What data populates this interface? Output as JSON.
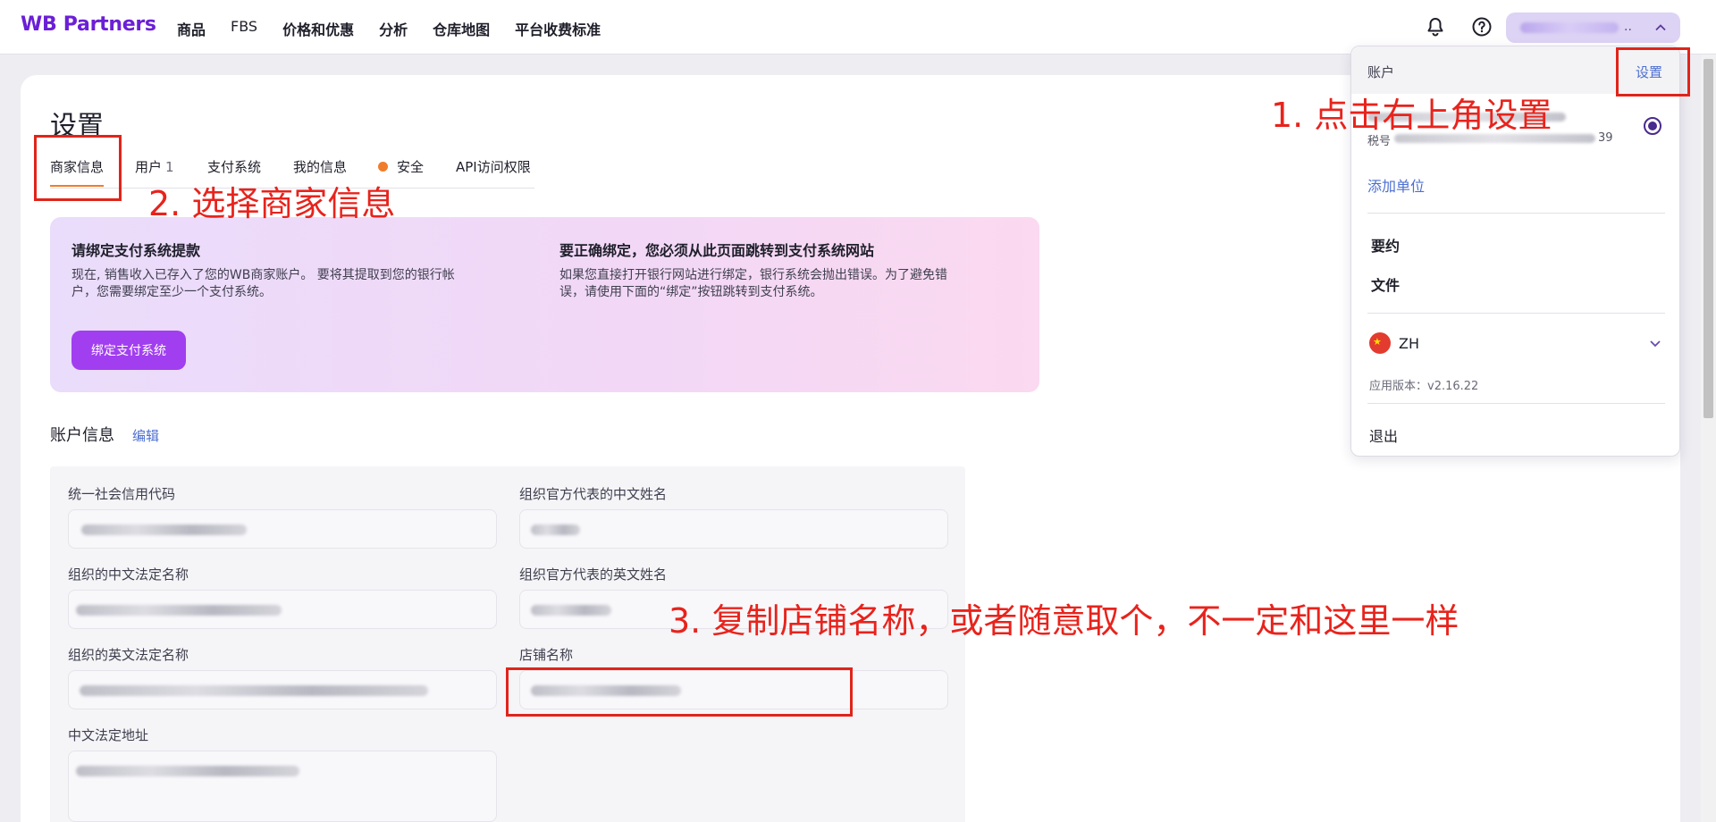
{
  "header": {
    "brand": "WB Partners",
    "nav": [
      "商品",
      "FBS",
      "价格和优惠",
      "分析",
      "仓库地图",
      "平台收费标准"
    ],
    "account_dots": ".."
  },
  "page": {
    "title": "设置",
    "tabs": [
      {
        "label": "商家信息",
        "active": true
      },
      {
        "label": "用户",
        "count": "1"
      },
      {
        "label": "支付系统"
      },
      {
        "label": "我的信息"
      },
      {
        "label": "安全",
        "dot": true
      },
      {
        "label": "API访问权限"
      }
    ]
  },
  "banner": {
    "left_title": "请绑定支付系统提款",
    "left_text_1": "现在, 销售收入已存入了您的WB商家账户。 要将其提取到您的银行帐",
    "left_text_2": "户，您需要绑定至少一个支付系统。",
    "right_title": "要正确绑定，您必须从此页面跳转到支付系统网站",
    "right_text_1": "如果您直接打开银行网站进行绑定，银行系统会抛出错误。为了避免错",
    "right_text_2": "误，请使用下面的“绑定”按钮跳转到支付系统。",
    "button": "绑定支付系统"
  },
  "account_info": {
    "title": "账户信息",
    "edit": "编辑",
    "fields": {
      "credit_code": "统一社会信用代码",
      "rep_cn_name": "组织官方代表的中文姓名",
      "org_cn_name": "组织的中文法定名称",
      "rep_en_name": "组织官方代表的英文姓名",
      "org_en_name": "组织的英文法定名称",
      "shop_name": "店铺名称",
      "cn_address": "中文法定地址"
    }
  },
  "dropdown": {
    "account_label": "账户",
    "settings_link": "设置",
    "tax_prefix": "税号",
    "tax_suffix": "39",
    "add_unit": "添加单位",
    "contract": "要约",
    "documents": "文件",
    "language": "ZH",
    "version": "应用版本：v2.16.22",
    "logout": "退出"
  },
  "annotations": {
    "step1": "1. 点击右上角设置",
    "step2": "2. 选择商家信息",
    "step3": "3. 复制店铺名称，或者随意取个，不一定和这里一样"
  },
  "colors": {
    "brand": "#6b1fd6",
    "accent_button": "#a13ef0",
    "link": "#4d6fd1",
    "tab_active": "#f07c2b",
    "annotation_red": "#e0241a"
  }
}
